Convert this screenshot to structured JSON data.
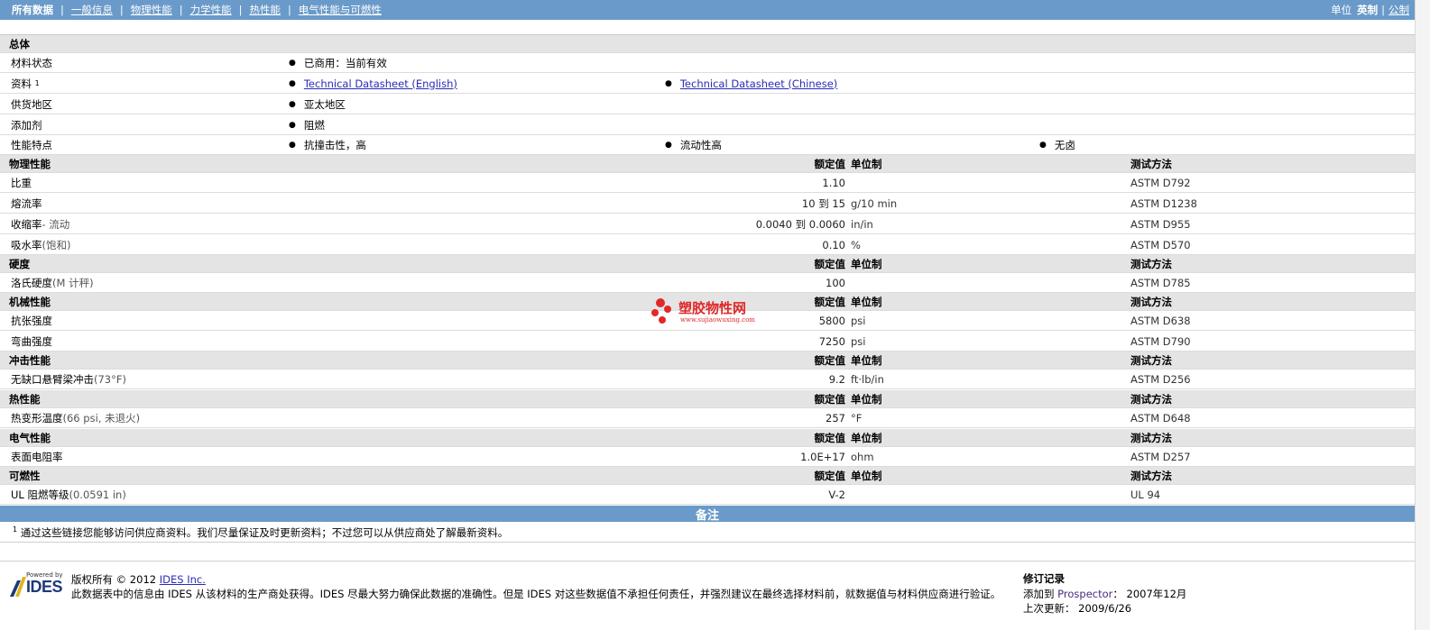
{
  "nav": {
    "tabs": [
      "所有数据",
      "一般信息",
      "物理性能",
      "力学性能",
      "热性能",
      "电气性能与可燃性"
    ],
    "units_label": "单位",
    "unit_options": [
      "英制",
      "公制"
    ],
    "active_unit": "英制"
  },
  "general": {
    "section_title": "总体",
    "rows": [
      {
        "label": "材料状态",
        "sup": "",
        "items": [
          "已商用：当前有效"
        ]
      },
      {
        "label": "资料",
        "sup": "1",
        "items": [
          "Technical Datasheet (English)",
          "Technical Datasheet (Chinese)"
        ]
      },
      {
        "label": "供货地区",
        "sup": "",
        "items": [
          "亚太地区"
        ]
      },
      {
        "label": "添加剂",
        "sup": "",
        "items": [
          "阻燃"
        ]
      },
      {
        "label": "性能特点",
        "sup": "",
        "items": [
          "抗撞击性，高",
          "流动性高",
          "无卤"
        ]
      }
    ]
  },
  "column_headers": {
    "value": "额定值",
    "unit": "单位制",
    "method": "测试方法"
  },
  "sections": [
    {
      "title": "物理性能",
      "rows": [
        {
          "label": "比重",
          "tag": "",
          "value": "1.10",
          "unit": "",
          "method": "ASTM D792"
        },
        {
          "label": "熔流率",
          "tag": "",
          "value": "10 到  15",
          "unit": "g/10 min",
          "method": "ASTM D1238"
        },
        {
          "label": "收缩率 ",
          "tag": "- 流动",
          "value": "0.0040 到  0.0060",
          "unit": "in/in",
          "method": "ASTM D955"
        },
        {
          "label": "吸水率 ",
          "tag": "(饱和)",
          "value": "0.10",
          "unit": "%",
          "method": "ASTM D570"
        }
      ]
    },
    {
      "title": "硬度",
      "rows": [
        {
          "label": "洛氏硬度 ",
          "tag": "(M 计秤)",
          "value": "100",
          "unit": "",
          "method": "ASTM D785"
        }
      ]
    },
    {
      "title": "机械性能",
      "rows": [
        {
          "label": "抗张强度",
          "tag": "",
          "value": "5800",
          "unit": "psi",
          "method": "ASTM D638"
        },
        {
          "label": "弯曲强度",
          "tag": "",
          "value": "7250",
          "unit": "psi",
          "method": "ASTM D790"
        }
      ]
    },
    {
      "title": "冲击性能",
      "rows": [
        {
          "label": "无缺口悬臂梁冲击 ",
          "tag": "(73°F)",
          "value": "9.2",
          "unit": "ft·lb/in",
          "method": "ASTM D256"
        }
      ]
    },
    {
      "title": "热性能",
      "rows": [
        {
          "label": "热变形温度 ",
          "tag": "(66 psi, 未退火)",
          "value": "257",
          "unit": "°F",
          "method": "ASTM D648"
        }
      ]
    },
    {
      "title": "电气性能",
      "rows": [
        {
          "label": "表面电阻率",
          "tag": "",
          "value": "1.0E+17",
          "unit": "ohm",
          "method": "ASTM D257"
        }
      ]
    },
    {
      "title": "可燃性",
      "rows": [
        {
          "label": "UL 阻燃等级 ",
          "tag": "(0.0591 in)",
          "value": "V-2",
          "unit": "",
          "method": "UL 94"
        }
      ]
    }
  ],
  "notes": {
    "title": "备注",
    "sup": "1",
    "text": "通过这些链接您能够访问供应商资料。我们尽量保证及时更新资料；不过您可以从供应商处了解最新资料。"
  },
  "footer": {
    "logo_powered": "Powered by",
    "logo_text": "IDES",
    "copyright_prefix": "版权所有 © 2012 ",
    "copyright_link": "IDES Inc.",
    "disclaimer": "此数据表中的信息由  IDES 从该材料的生产商处获得。IDES 尽最大努力确保此数据的准确性。但是  IDES 对这些数据值不承担任何责任，并强烈建议在最终选择材料前，就数据值与材料供应商进行验证。",
    "revision_title": "修订记录",
    "added_label": "添加到  ",
    "added_product": "Prospector",
    "added_date": "：  2007年12月",
    "updated_label": "上次更新：  2009/6/26"
  },
  "watermark": {
    "title": "塑胶物性网",
    "url": "www.sujiaowuxing.com"
  }
}
